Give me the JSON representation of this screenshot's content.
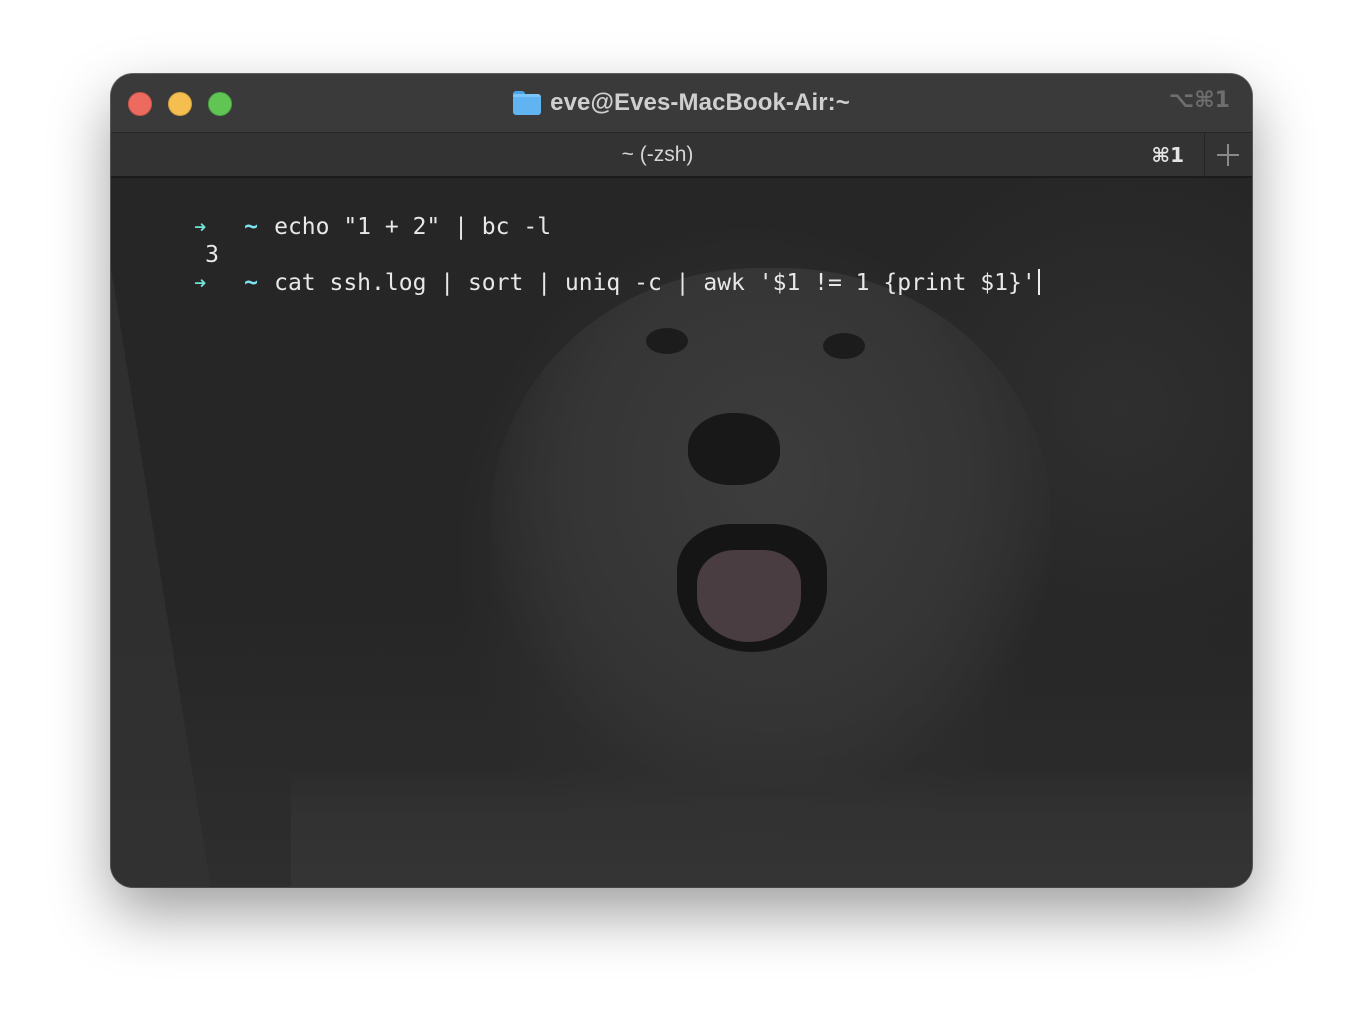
{
  "window": {
    "title": "eve@Eves-MacBook-Air:~",
    "title_icon": "folder-icon",
    "shortcut": "⌥⌘1"
  },
  "tabs": [
    {
      "label": "~ (-zsh)",
      "shortcut": "⌘1",
      "active": true
    }
  ],
  "new_tab_icon": "plus-icon",
  "terminal": {
    "lines": [
      {
        "type": "command",
        "prompt": "➜",
        "cwd": "~",
        "text": "echo \"1 + 2\" | bc -l"
      },
      {
        "type": "output",
        "text": "3"
      },
      {
        "type": "command",
        "prompt": "➜",
        "cwd": "~",
        "text": "cat ssh.log | sort | uniq -c | awk '$1 != 1 {print $1}'"
      }
    ]
  },
  "colors": {
    "prompt_arrow": "#6fe3d8",
    "prompt_cwd": "#7ee2f0",
    "text": "#e8e8e8",
    "close": "#ec6a5e",
    "minimize": "#f4bf4f",
    "maximize": "#61c554"
  }
}
